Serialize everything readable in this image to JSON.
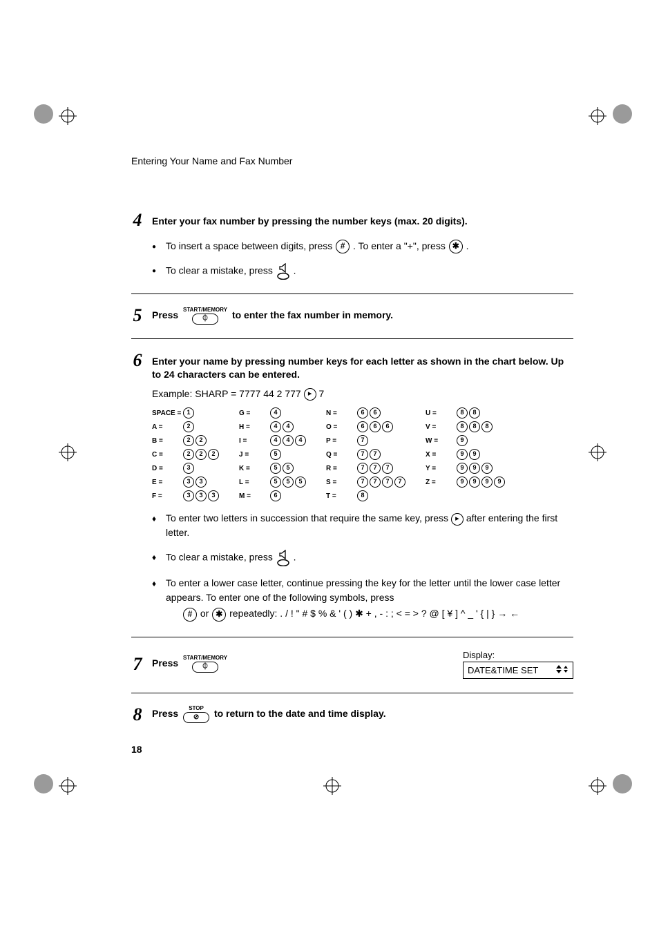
{
  "breadcrumb": "Entering Your Name and Fax Number",
  "page_number": "18",
  "steps": {
    "s4": {
      "num": "4",
      "title": "Enter your fax number by pressing the number keys (max. 20 digits).",
      "b1_a": "To insert a space between digits, press ",
      "b1_b": ". To enter a \"+\", press ",
      "b1_c": ".",
      "b2_a": "To clear a mistake, press ",
      "b2_b": "."
    },
    "s5": {
      "num": "5",
      "press": "Press",
      "btn": "START/MEMORY",
      "tail": " to enter the fax number in memory."
    },
    "s6": {
      "num": "6",
      "title": "Enter your name by pressing number keys for each letter as shown in the chart below. Up to 24 characters can be entered.",
      "example_a": "Example: SHARP = 7777  44  2  777 ",
      "example_b": " 7",
      "d1_a": "To enter two letters in succession that require the same key, press ",
      "d1_b": " after entering the first letter.",
      "d2_a": "To clear a mistake, press ",
      "d2_b": ".",
      "d3_a": "To enter a lower case letter, continue pressing the key for the letter until the lower case letter appears. To enter one of the following symbols, press",
      "d3_or": " or ",
      "d3_tail": " repeatedly: . / ! \" # $ % & ' ( ) ✱ + , - : ; < = > ? @ [ ¥ ] ^ _ ' { | } → ←"
    },
    "s7": {
      "num": "7",
      "press": "Press",
      "btn": "START/MEMORY",
      "display_label": "Display:",
      "display_value": "DATE&TIME SET"
    },
    "s8": {
      "num": "8",
      "press": "Press",
      "btn": "STOP",
      "tail": " to return to the date and time display."
    }
  },
  "chart_data": {
    "type": "table",
    "title": "Letter entry chart",
    "columns": [
      [
        {
          "label": "SPACE =",
          "keys": [
            "1"
          ]
        },
        {
          "label": "A =",
          "keys": [
            "2"
          ]
        },
        {
          "label": "B =",
          "keys": [
            "2",
            "2"
          ]
        },
        {
          "label": "C =",
          "keys": [
            "2",
            "2",
            "2"
          ]
        },
        {
          "label": "D =",
          "keys": [
            "3"
          ]
        },
        {
          "label": "E =",
          "keys": [
            "3",
            "3"
          ]
        },
        {
          "label": "F =",
          "keys": [
            "3",
            "3",
            "3"
          ]
        }
      ],
      [
        {
          "label": "G =",
          "keys": [
            "4"
          ]
        },
        {
          "label": "H =",
          "keys": [
            "4",
            "4"
          ]
        },
        {
          "label": "I =",
          "keys": [
            "4",
            "4",
            "4"
          ]
        },
        {
          "label": "J =",
          "keys": [
            "5"
          ]
        },
        {
          "label": "K =",
          "keys": [
            "5",
            "5"
          ]
        },
        {
          "label": "L =",
          "keys": [
            "5",
            "5",
            "5"
          ]
        },
        {
          "label": "M =",
          "keys": [
            "6"
          ]
        }
      ],
      [
        {
          "label": "N =",
          "keys": [
            "6",
            "6"
          ]
        },
        {
          "label": "O =",
          "keys": [
            "6",
            "6",
            "6"
          ]
        },
        {
          "label": "P =",
          "keys": [
            "7"
          ]
        },
        {
          "label": "Q =",
          "keys": [
            "7",
            "7"
          ]
        },
        {
          "label": "R =",
          "keys": [
            "7",
            "7",
            "7"
          ]
        },
        {
          "label": "S =",
          "keys": [
            "7",
            "7",
            "7",
            "7"
          ]
        },
        {
          "label": "T =",
          "keys": [
            "8"
          ]
        }
      ],
      [
        {
          "label": "U =",
          "keys": [
            "8",
            "8"
          ]
        },
        {
          "label": "V =",
          "keys": [
            "8",
            "8",
            "8"
          ]
        },
        {
          "label": "W =",
          "keys": [
            "9"
          ]
        },
        {
          "label": "X =",
          "keys": [
            "9",
            "9"
          ]
        },
        {
          "label": "Y =",
          "keys": [
            "9",
            "9",
            "9"
          ]
        },
        {
          "label": "Z =",
          "keys": [
            "9",
            "9",
            "9",
            "9"
          ]
        }
      ]
    ]
  },
  "icons": {
    "hash": "#",
    "star": "✱",
    "stop_glyph": "◯",
    "start_glyph": "◔"
  }
}
